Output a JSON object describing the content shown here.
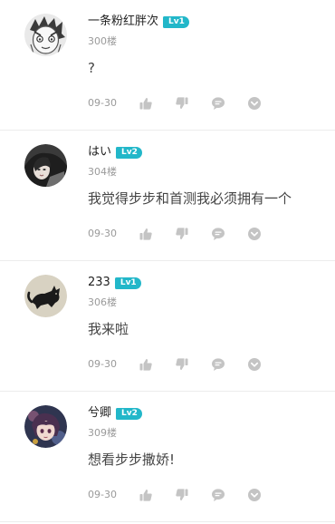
{
  "comments": [
    {
      "username": "一条粉红胖次",
      "level": "Lv1",
      "floor": "300楼",
      "content": "?",
      "date": "09-30",
      "avatar_icon": "manga-face-avatar-icon"
    },
    {
      "username": "はい",
      "level": "Lv2",
      "floor": "304楼",
      "content": "我觉得步步和首测我必须拥有一个",
      "date": "09-30",
      "avatar_icon": "girl-portrait-avatar-icon"
    },
    {
      "username": "233",
      "level": "Lv1",
      "floor": "306楼",
      "content": "我来啦",
      "date": "09-30",
      "avatar_icon": "black-cat-avatar-icon"
    },
    {
      "username": "兮卿",
      "level": "Lv2",
      "floor": "309楼",
      "content": "想看步步撒娇!",
      "date": "09-30",
      "avatar_icon": "anime-character-avatar-icon"
    }
  ],
  "actions": {
    "like_icon": "thumbs-up-icon",
    "dislike_icon": "thumbs-down-icon",
    "reply_icon": "speech-bubble-icon",
    "more_icon": "chevron-down-circle-icon"
  },
  "colors": {
    "level_badge": "#22b7c9",
    "meta_text": "#9a9a9a",
    "action_icon": "#c4c4c4",
    "divider": "#ececec"
  }
}
